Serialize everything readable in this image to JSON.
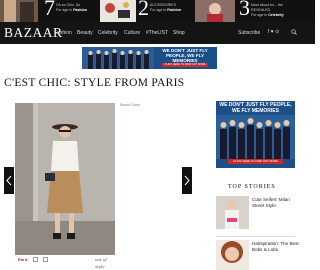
{
  "promo_strip": {
    "items": [
      {
        "number": "7",
        "line1": "Oh so Chic, So",
        "line2": "Fashion",
        "tag_prefix": "For age in "
      },
      {
        "number": "2",
        "line1": "ACCESSORIES",
        "line2": "Fashion",
        "tag_prefix": "For age in "
      },
      {
        "number": "3",
        "line1": "Most about for... the",
        "line2": "REVEALED",
        "line3": "Celebrity",
        "tag_prefix": "For age in "
      }
    ]
  },
  "nav": {
    "logo": "BAZAAR",
    "links": [
      "Fashion",
      "Beauty",
      "Celebrity",
      "Culture",
      "#TheLIST",
      "Shop"
    ],
    "subscribe": "Subscribe",
    "social": "f  ♥  ⊙"
  },
  "top_ad": {
    "text": "WE DON'T JUST FLY PEOPLE, WE FLY MEMORIES",
    "button": "CLICK HERE TO FIND OUT MORE"
  },
  "article": {
    "headline": "C'EST CHIC: STYLE FROM PARIS",
    "credit": "Based Sales",
    "share": {
      "pin": "Pin it",
      "signature": "out of style"
    }
  },
  "side_ad": {
    "text": "WE DON'T JUST FLY PEOPLE, WE FLY MEMORIES",
    "button": "CLICK HERE TO FIND OUT MORE"
  },
  "top_stories": {
    "heading": "TOP STORIES",
    "items": [
      {
        "title": "Cote Seifert: Milan Street Style"
      },
      {
        "title": "Hairspiration: The Best Bobs & Lobs"
      }
    ]
  },
  "colors": {
    "nav_bg": "#141414",
    "ad_blue": "#1b4f8a",
    "ad_red": "#c92a2a",
    "pinterest": "#bd081c"
  }
}
